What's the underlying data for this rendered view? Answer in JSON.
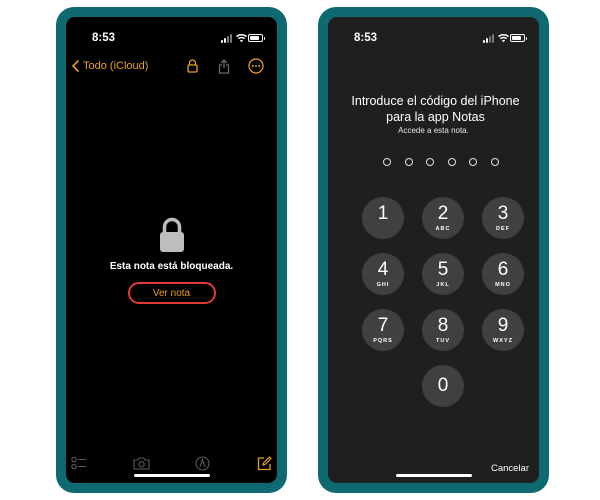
{
  "left_phone": {
    "status_time": "8:53",
    "back_label": "Todo (iCloud)",
    "locked_message": "Esta nota está bloqueada.",
    "view_note_label": "Ver nota",
    "nav_icons": [
      "lock-icon",
      "share-icon",
      "more-icon"
    ],
    "toolbar_icons": [
      "checklist-icon",
      "camera-icon",
      "markup-icon",
      "compose-icon"
    ]
  },
  "right_phone": {
    "status_time": "8:53",
    "passcode_title": "Introduce el código del iPhone para la app Notas",
    "passcode_subtitle": "Accede a esta nota.",
    "passcode_length": 6,
    "keys": [
      {
        "digit": "1",
        "letters": ""
      },
      {
        "digit": "2",
        "letters": "ABC"
      },
      {
        "digit": "3",
        "letters": "DEF"
      },
      {
        "digit": "4",
        "letters": "GHI"
      },
      {
        "digit": "5",
        "letters": "JKL"
      },
      {
        "digit": "6",
        "letters": "MNO"
      },
      {
        "digit": "7",
        "letters": "PQRS"
      },
      {
        "digit": "8",
        "letters": "TUV"
      },
      {
        "digit": "9",
        "letters": "WXYZ"
      },
      {
        "digit": "0",
        "letters": ""
      }
    ],
    "cancel_label": "Cancelar"
  },
  "colors": {
    "frame": "#0f6970",
    "accent": "#e6a020",
    "highlight": "#e23b37",
    "key_background": "#404040",
    "screen_left": "#000000",
    "screen_right": "#1f1f1f"
  }
}
